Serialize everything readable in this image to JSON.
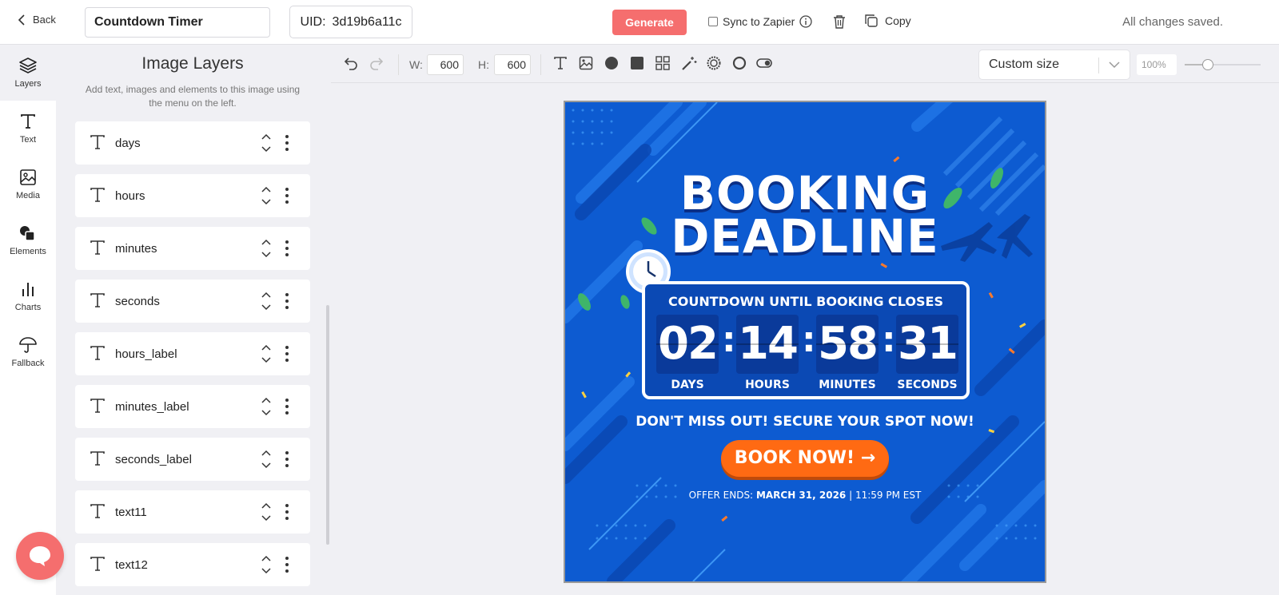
{
  "header": {
    "back_label": "Back",
    "template_name": "Countdown Timer",
    "uid_label": "UID:",
    "uid_value": "3d19b6a11c",
    "generate_label": "Generate",
    "sync_label": "Sync to Zapier",
    "copy_label": "Copy",
    "status": "All changes saved."
  },
  "rail": {
    "items": [
      {
        "label": "Layers",
        "icon": "layers-icon"
      },
      {
        "label": "Text",
        "icon": "text-icon"
      },
      {
        "label": "Media",
        "icon": "image-icon"
      },
      {
        "label": "Elements",
        "icon": "shapes-icon"
      },
      {
        "label": "Charts",
        "icon": "bar-chart-icon"
      },
      {
        "label": "Fallback",
        "icon": "umbrella-icon"
      }
    ]
  },
  "panel": {
    "title": "Image Layers",
    "subtitle": "Add text, images and elements to this image using the menu on the left.",
    "layers": [
      {
        "name": "days"
      },
      {
        "name": "hours"
      },
      {
        "name": "minutes"
      },
      {
        "name": "seconds"
      },
      {
        "name": "hours_label"
      },
      {
        "name": "minutes_label"
      },
      {
        "name": "seconds_label"
      },
      {
        "name": "text11"
      },
      {
        "name": "text12"
      }
    ]
  },
  "toolbar": {
    "width_label": "W:",
    "width_value": "600",
    "height_label": "H:",
    "height_value": "600",
    "size_preset": "Custom size",
    "zoom": "100%",
    "zoom_level": 0.3
  },
  "artwork": {
    "headline_line1": "BOOKING",
    "headline_line2": "DEADLINE",
    "countdown_title": "COUNTDOWN UNTIL BOOKING CLOSES",
    "days": "02",
    "hours": "14",
    "minutes": "58",
    "seconds": "31",
    "days_label": "DAYS",
    "hours_label": "HOURS",
    "minutes_label": "MINUTES",
    "seconds_label": "SECONDS",
    "tagline": "DON'T MISS OUT! SECURE YOUR SPOT NOW!",
    "cta": "BOOK NOW! →",
    "offer_prefix": "OFFER ENDS:",
    "offer_date": "MARCH 31, 2026",
    "offer_sep": "|",
    "offer_time": "11:59 PM EST"
  },
  "colors": {
    "accent": "#f56e6e",
    "art_background": "#0d5bd1",
    "cta": "#ff6a13"
  }
}
